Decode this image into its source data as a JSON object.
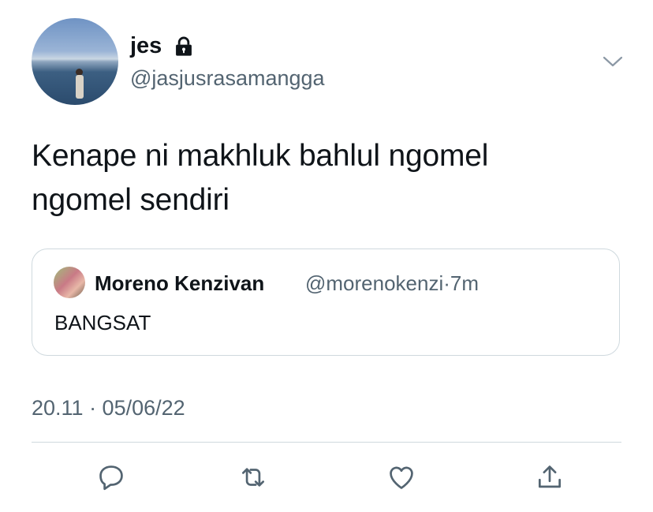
{
  "tweet": {
    "author": {
      "display_name": "jes",
      "handle": "@jasjusrasamangga",
      "protected_icon": "lock-icon"
    },
    "text_line1": "Kenape ni makhluk bahlul ngomel",
    "text_line2": "ngomel sendiri",
    "quoted": {
      "display_name": "Moreno Kenzivan",
      "handle_time": "@morenokenzi·7m",
      "text": "BANGSAT"
    },
    "timestamp": "20.11 · 05/06/22"
  },
  "actions": {
    "reply_icon": "reply-icon",
    "retweet_icon": "retweet-icon",
    "like_icon": "heart-icon",
    "share_icon": "share-icon"
  },
  "menu_icon": "chevron-down-icon",
  "colors": {
    "text": "#0f1419",
    "secondary": "#536471",
    "border": "#cfd9de"
  }
}
